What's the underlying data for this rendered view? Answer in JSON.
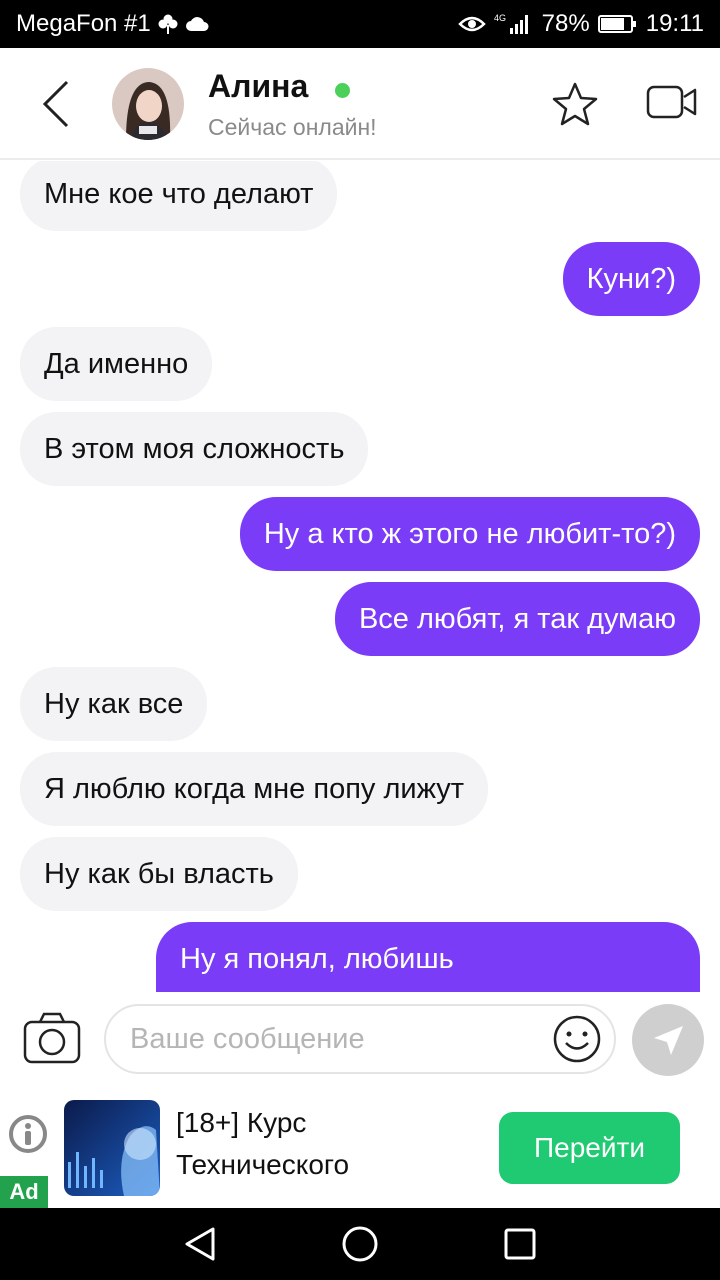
{
  "status_bar": {
    "carrier": "MegaFon #1",
    "network": "4G",
    "battery": "78%",
    "time": "19:11"
  },
  "header": {
    "contact_name": "Алина",
    "status": "Сейчас онлайн!",
    "online_color": "#4cd05a"
  },
  "messages": [
    {
      "direction": "in",
      "text": "Мне кое что делают"
    },
    {
      "direction": "out",
      "text": "Куни?)"
    },
    {
      "direction": "in",
      "text": "Да именно"
    },
    {
      "direction": "in",
      "text": "В этом моя сложность"
    },
    {
      "direction": "out",
      "text": "Ну а кто ж этого не любит-то?)"
    },
    {
      "direction": "out",
      "text": "Все любят, я так думаю"
    },
    {
      "direction": "in",
      "text": "Ну как все"
    },
    {
      "direction": "in",
      "text": "Я люблю когда мне попу лижут"
    },
    {
      "direction": "in",
      "text": "Ну как бы власть"
    },
    {
      "direction": "out",
      "text": "Ну я понял, любишь"
    }
  ],
  "input": {
    "placeholder": "Ваше сообщение",
    "value": ""
  },
  "ad": {
    "label": "Ad",
    "title": "[18+] Курс Технического",
    "cta": "Перейти"
  },
  "colors": {
    "outgoing_bubble": "#7a3cf6",
    "incoming_bubble": "#f3f3f5",
    "cta": "#1fca72"
  },
  "icons": [
    "back-arrow-icon",
    "star-icon",
    "video-camera-icon",
    "camera-icon",
    "smiley-icon",
    "send-icon",
    "info-icon",
    "nav-back-icon",
    "nav-home-icon",
    "nav-recents-icon"
  ]
}
